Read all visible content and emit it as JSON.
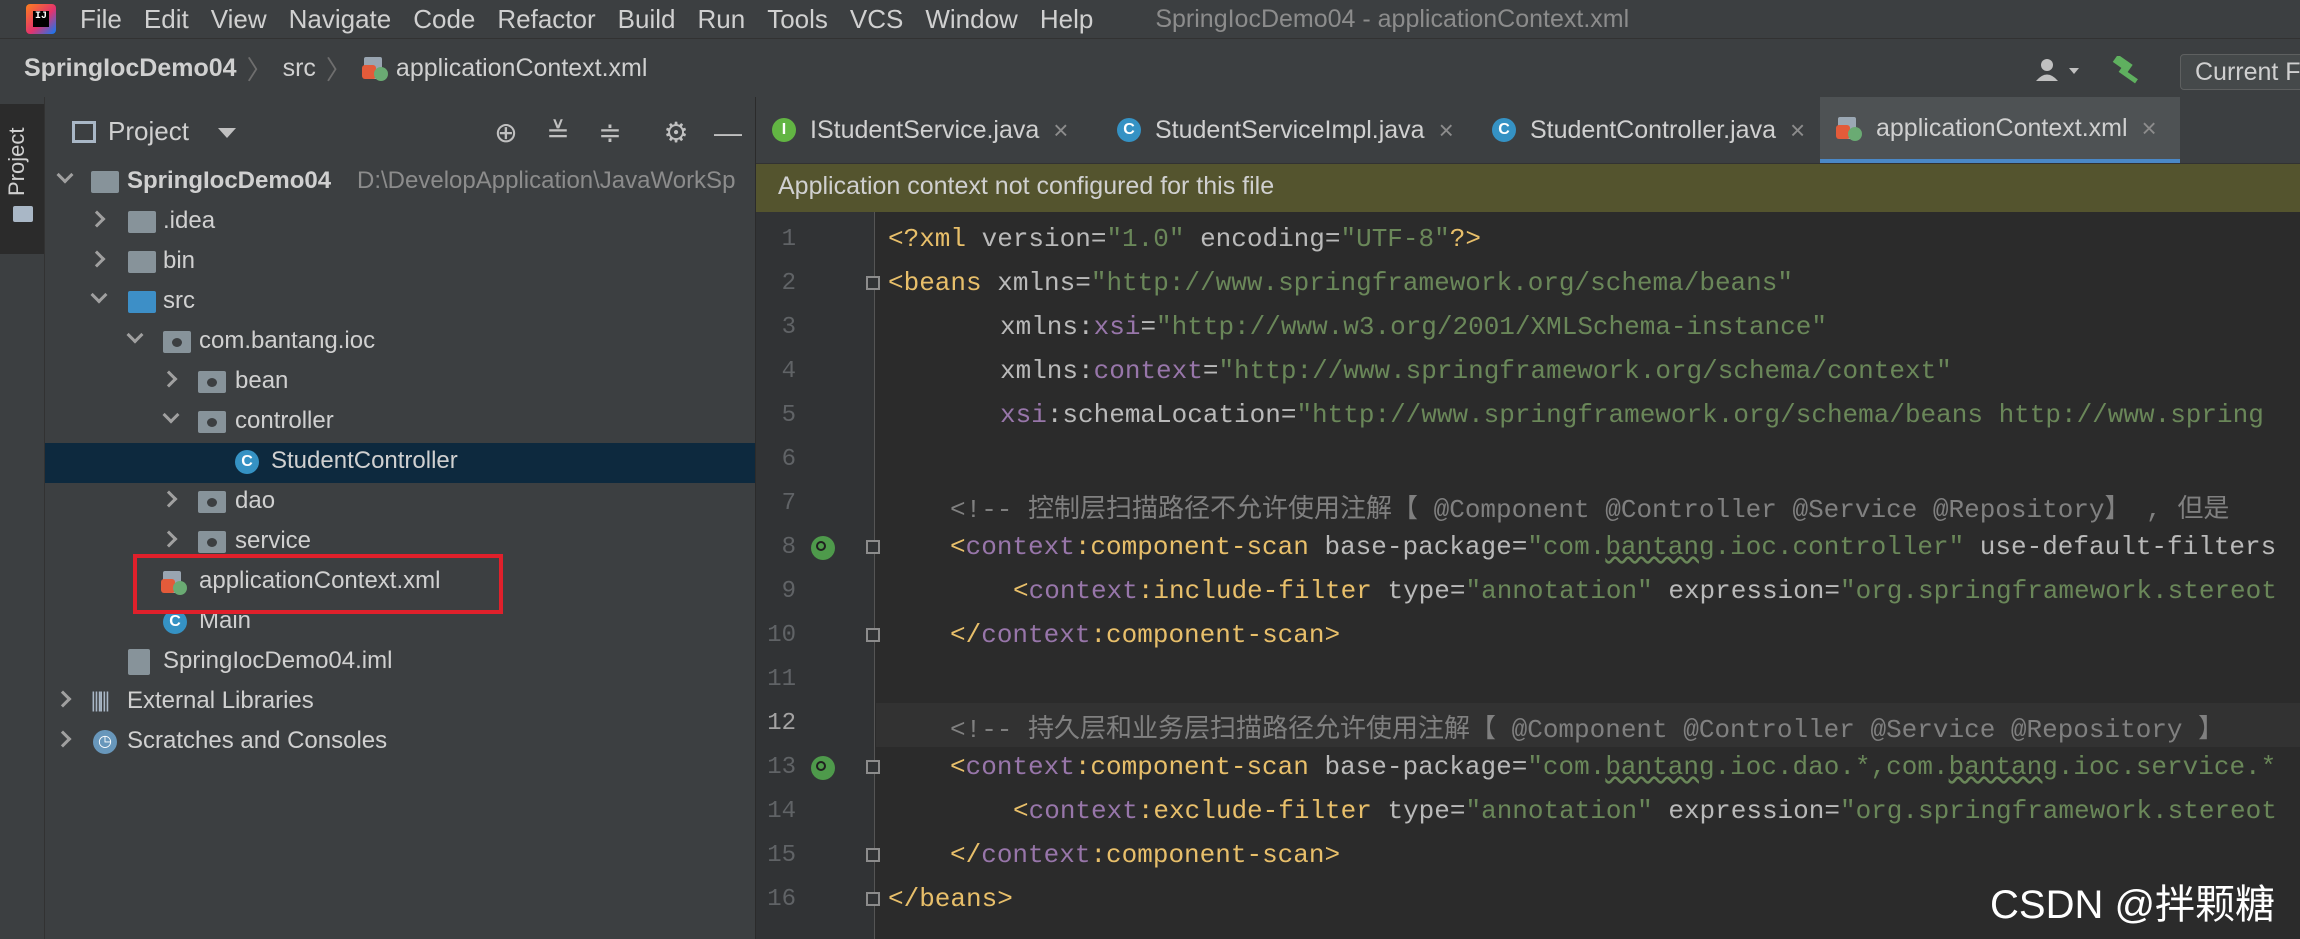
{
  "menu": [
    "File",
    "Edit",
    "View",
    "Navigate",
    "Code",
    "Refactor",
    "Build",
    "Run",
    "Tools",
    "VCS",
    "Window",
    "Help"
  ],
  "window_title": "SpringIocDemo04 - applicationContext.xml",
  "breadcrumb": {
    "project": "SpringIocDemo04",
    "folder": "src",
    "file": "applicationContext.xml"
  },
  "run_config": "Current F",
  "project_panel": {
    "tab_label": "Project",
    "title": "Project",
    "tree": [
      {
        "label": "SpringIocDemo04",
        "path": "D:\\DevelopApplication\\JavaWorkSp"
      },
      {
        "label": ".idea"
      },
      {
        "label": "bin"
      },
      {
        "label": "src"
      },
      {
        "label": "com.bantang.ioc"
      },
      {
        "label": "bean"
      },
      {
        "label": "controller"
      },
      {
        "label": "StudentController"
      },
      {
        "label": "dao"
      },
      {
        "label": "service"
      },
      {
        "label": "applicationContext.xml"
      },
      {
        "label": "Main"
      },
      {
        "label": "SpringIocDemo04.iml"
      },
      {
        "label": "External Libraries"
      },
      {
        "label": "Scratches and Consoles"
      }
    ]
  },
  "tabs": [
    {
      "label": "IStudentService.java",
      "icon": "I"
    },
    {
      "label": "StudentServiceImpl.java",
      "icon": "C"
    },
    {
      "label": "StudentController.java",
      "icon": "C"
    },
    {
      "label": "applicationContext.xml",
      "icon": "xml"
    }
  ],
  "banner": "Application context not configured for this file",
  "line_numbers": [
    "1",
    "2",
    "3",
    "4",
    "5",
    "6",
    "7",
    "8",
    "9",
    "10",
    "11",
    "12",
    "13",
    "14",
    "15",
    "16"
  ],
  "code": {
    "l1": {
      "a": "<?xml",
      "b": " version=",
      "c": "\"1.0\"",
      "d": " encoding=",
      "e": "\"UTF-8\"",
      "f": "?>"
    },
    "l2": {
      "a": "<beans",
      "b": " xmlns=",
      "c": "\"http://www.springframework.org/schema/beans\""
    },
    "l3": {
      "a": "xmlns:",
      "b": "xsi",
      "c": "=",
      "d": "\"http://www.w3.org/2001/XMLSchema-instance\""
    },
    "l4": {
      "a": "xmlns:",
      "b": "context",
      "c": "=",
      "d": "\"http://www.springframework.org/schema/context\""
    },
    "l5": {
      "a": "xsi",
      "b": ":schemaLocation=",
      "c": "\"http://www.springframework.org/schema/beans http://www.spring"
    },
    "l7": "<!-- 控制层扫描路径不允许使用注解【 @Component @Controller @Service @Repository】 , 但是",
    "l8": {
      "a": "<",
      "b": "context",
      "c": ":component-scan",
      "d": " base-package=",
      "e": "\"com.",
      "f": "bantang",
      "g": ".ioc.controller\"",
      "h": " use-default-filters"
    },
    "l9": {
      "a": "<",
      "b": "context",
      "c": ":include-filter",
      "d": " type=",
      "e": "\"annotation\"",
      "f": " expression=",
      "g": "\"org.springframework.stereot"
    },
    "l10": {
      "a": "</",
      "b": "context",
      "c": ":component-scan>"
    },
    "l12": "<!-- 持久层和业务层扫描路径允许使用注解【 @Component @Controller @Service @Repository 】",
    "l13": {
      "a": "<",
      "b": "context",
      "c": ":component-scan",
      "d": " base-package=",
      "e": "\"com.",
      "f": "bantang",
      "g": ".ioc.dao.*,com.",
      "h": "bantang",
      "i": ".ioc.service.*"
    },
    "l14": {
      "a": "<",
      "b": "context",
      "c": ":exclude-filter",
      "d": " type=",
      "e": "\"annotation\"",
      "f": " expression=",
      "g": "\"org.springframework.stereot"
    },
    "l15": {
      "a": "</",
      "b": "context",
      "c": ":component-scan>"
    },
    "l16": "</beans>"
  },
  "watermark": "CSDN @拌颗糖",
  "colors": {
    "highlight_box": "#e0202b",
    "banner_bg": "#54542e",
    "selection": "#0d293e"
  }
}
